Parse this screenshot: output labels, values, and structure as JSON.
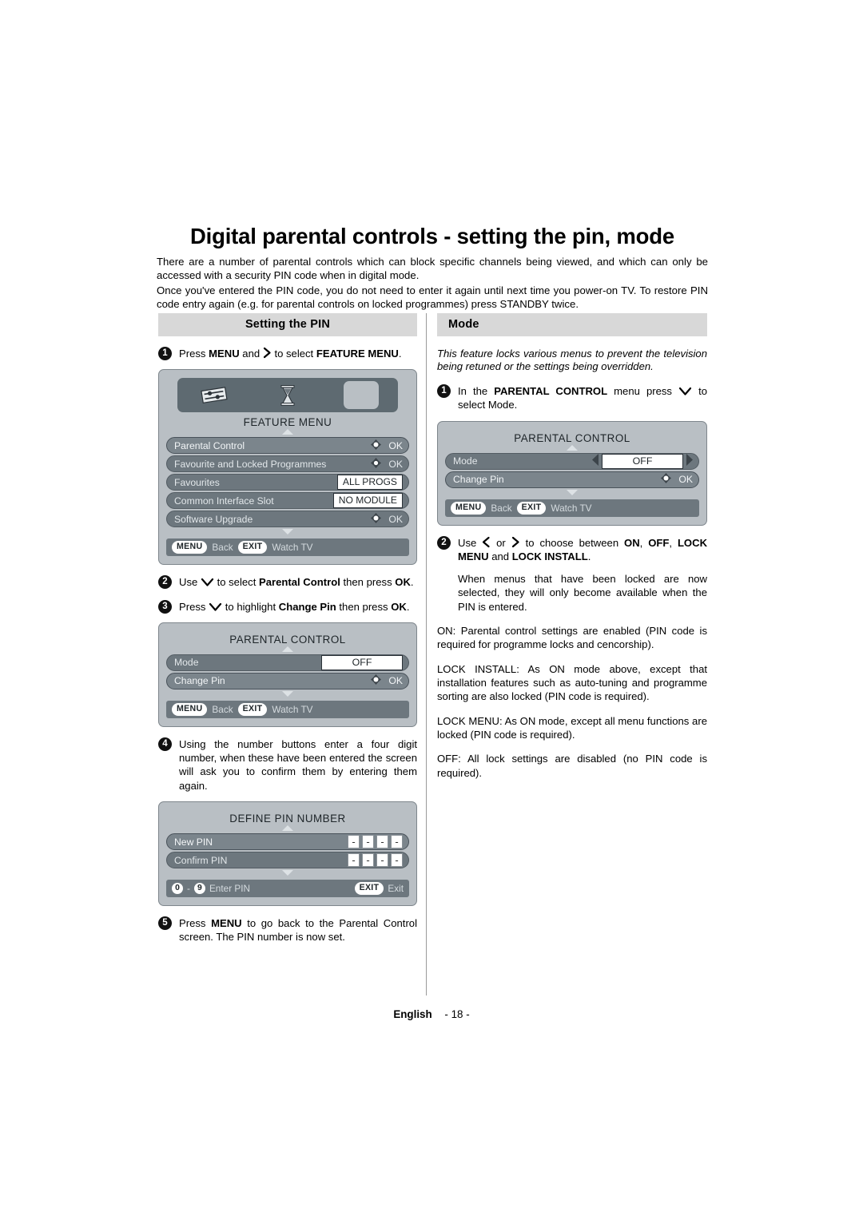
{
  "document": {
    "title": "Digital parental controls - setting the pin, mode",
    "intro": [
      "There are a number of parental controls which can block specific channels being viewed, and which can only be accessed with a security PIN code when in digital mode.",
      "Once you've entered the PIN code, you do not need to enter it again until next time you power-on TV. To restore PIN code entry again (e.g. for parental controls on locked programmes) press STANDBY twice."
    ],
    "footer": {
      "language": "English",
      "page": "- 18 -"
    }
  },
  "left_column": {
    "header": "Setting the PIN",
    "step1": {
      "number": "1",
      "text_before": "Press MENU and",
      "text_after": "to select FEATURE MENU."
    },
    "feature_menu_panel": {
      "title": "FEATURE MENU",
      "icons": [
        "sliders-icon",
        "hourglass-icon",
        "selected-tab"
      ],
      "rows": [
        {
          "label": "Parental Control",
          "value": "OK",
          "type": "ok",
          "selected": true
        },
        {
          "label": "Favourite and Locked Programmes",
          "value": "OK",
          "type": "ok",
          "selected": false
        },
        {
          "label": "Favourites",
          "value": "ALL PROGS",
          "type": "box",
          "selected": false
        },
        {
          "label": "Common Interface Slot",
          "value": "NO MODULE",
          "type": "box",
          "selected": false
        },
        {
          "label": "Software Upgrade",
          "value": "OK",
          "type": "ok",
          "selected": false
        }
      ],
      "footer": {
        "key1": "MENU",
        "action1": "Back",
        "key2": "EXIT",
        "action2": "Watch TV"
      }
    },
    "step2": {
      "number": "2",
      "text_before": "Use",
      "text_after": "to select Parental Control then press OK."
    },
    "step3": {
      "number": "3",
      "text_before": "Press",
      "text_after": "to highlight Change Pin then press OK."
    },
    "parental_control_panel": {
      "title": "PARENTAL CONTROL",
      "rows": [
        {
          "label": "Mode",
          "value": "OFF",
          "type": "wide",
          "selected": false
        },
        {
          "label": "Change Pin",
          "value": "OK",
          "type": "ok",
          "selected": true
        }
      ],
      "footer": {
        "key1": "MENU",
        "action1": "Back",
        "key2": "EXIT",
        "action2": "Watch TV"
      }
    },
    "step4": {
      "number": "4",
      "text": "Using the number buttons enter a four digit number, when these have been entered the screen will ask you to confirm them by entering them again."
    },
    "define_pin_panel": {
      "title": "DEFINE PIN NUMBER",
      "rows": [
        {
          "label": "New PIN",
          "digits": [
            "-",
            "-",
            "-",
            "-"
          ],
          "selected": true
        },
        {
          "label": "Confirm PIN",
          "digits": [
            "-",
            "-",
            "-",
            "-"
          ],
          "selected": false
        }
      ],
      "footer": {
        "key_from": "0",
        "separator": "-",
        "key_to": "9",
        "action1": "Enter PIN",
        "key2": "EXIT",
        "action2": "Exit"
      }
    },
    "step5": {
      "number": "5",
      "text": "Press MENU to go back to the Parental Control screen. The PIN number is now set."
    }
  },
  "right_column": {
    "header": "Mode",
    "intro_italic": "This feature locks various menus to prevent the television being retuned or the settings being overridden.",
    "step1": {
      "number": "1",
      "text_before": "In the PARENTAL CONTROL menu press",
      "text_after": "to select Mode."
    },
    "parental_control_panel": {
      "title": "PARENTAL CONTROL",
      "rows": [
        {
          "label": "Mode",
          "value": "OFF",
          "type": "wide-arrows",
          "selected": false
        },
        {
          "label": "Change Pin",
          "value": "OK",
          "type": "ok",
          "selected": true
        }
      ],
      "footer": {
        "key1": "MENU",
        "action1": "Back",
        "key2": "EXIT",
        "action2": "Watch TV"
      }
    },
    "step2": {
      "number": "2",
      "text_before": "Use",
      "text_mid": "or",
      "text_after": "to choose between ON, OFF, LOCK MENU and LOCK INSTALL."
    },
    "paragraphs": [
      "When menus that have been locked are now selected, they will only become available when the PIN is entered.",
      "ON: Parental control settings are enabled (PIN code is required for programme locks and cencorship).",
      "LOCK INSTALL: As ON mode above, except that installation features such as auto-tuning and programme sorting are also locked (PIN code is required).",
      "LOCK MENU: As ON mode, except all menu functions are locked (PIN code is required).",
      "OFF: All lock settings are disabled (no PIN code is required)."
    ]
  },
  "colors": {
    "osd_background": "#b9bfc4",
    "osd_row": "#6d777e",
    "osd_row_selected": "#7b858c",
    "osd_iconbar": "#5e6a71",
    "section_header": "#d8d8d8",
    "text": "#000000"
  }
}
